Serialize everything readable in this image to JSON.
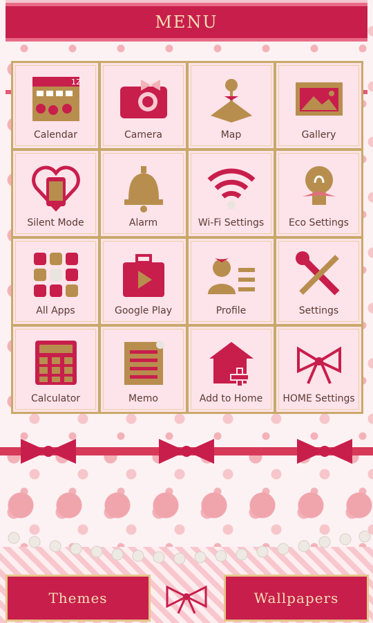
{
  "header": {
    "title": "MENU"
  },
  "tiles": [
    {
      "label": "Calendar",
      "icon": "calendar-icon",
      "badge": "12"
    },
    {
      "label": "Camera",
      "icon": "camera-icon"
    },
    {
      "label": "Map",
      "icon": "map-icon"
    },
    {
      "label": "Gallery",
      "icon": "gallery-icon"
    },
    {
      "label": "Silent Mode",
      "icon": "silent-mode-icon"
    },
    {
      "label": "Alarm",
      "icon": "alarm-bell-icon"
    },
    {
      "label": "Wi-Fi Settings",
      "icon": "wifi-icon"
    },
    {
      "label": "Eco Settings",
      "icon": "eco-bulb-icon"
    },
    {
      "label": "All Apps",
      "icon": "all-apps-icon"
    },
    {
      "label": "Google Play",
      "icon": "google-play-icon"
    },
    {
      "label": "Profile",
      "icon": "profile-icon"
    },
    {
      "label": "Settings",
      "icon": "settings-tools-icon"
    },
    {
      "label": "Calculator",
      "icon": "calculator-icon"
    },
    {
      "label": "Memo",
      "icon": "memo-icon"
    },
    {
      "label": "Add to Home",
      "icon": "add-to-home-icon"
    },
    {
      "label": "HOME Settings",
      "icon": "ribbon-bow-icon"
    }
  ],
  "bottom": {
    "themes_label": "Themes",
    "wallpapers_label": "Wallpapers"
  },
  "colors": {
    "crimson": "#c81e4c",
    "gold": "#c9a96a",
    "tile_bg": "#fde3ea"
  }
}
